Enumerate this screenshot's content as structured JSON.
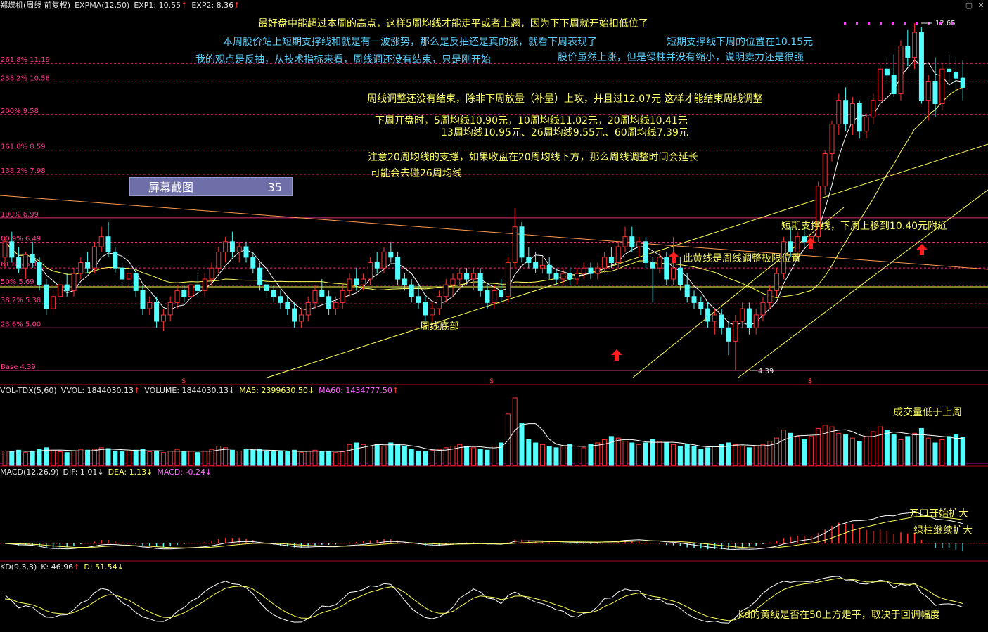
{
  "header": {
    "title": "郑煤机(周线 前复权)",
    "indicator": "EXPMA(12,50)",
    "exp1": "EXP1: 10.55",
    "exp1_arrow": "↑",
    "exp2": "EXP2: 8.36",
    "exp2_arrow": "↑"
  },
  "vol_header": {
    "name": "VOL-TDX(5,60)",
    "vvol": "VVOL: 1844030.13",
    "vvol_arrow": "↑",
    "volume": "VOLUME: 1844030.13",
    "volume_arrow": "↓",
    "ma5": "MA5: 2399630.50",
    "ma5_arrow": "↓",
    "ma60": "MA60: 1434777.50",
    "ma60_arrow": "↑"
  },
  "macd_header": {
    "name": "MACD(12,26,9)",
    "dif": "DIF: 1.01",
    "dif_arrow": "↓",
    "dea": "DEA: 1.13",
    "dea_arrow": "↓",
    "macd": "MACD: -0.24",
    "macd_arrow": "↓"
  },
  "kd_header": {
    "name": "KD(9,3,3)",
    "k": "K: 46.96",
    "k_arrow": "↑",
    "d": "D: 51.54",
    "d_arrow": "↓"
  },
  "screenshot_box": {
    "label": "屏幕截图",
    "number": "35"
  },
  "fib_levels": [
    {
      "label": "261.8% 11.19",
      "price": 11.19
    },
    {
      "label": "238.2% 10.58",
      "price": 10.58
    },
    {
      "label": "200% 9.58",
      "price": 9.58
    },
    {
      "label": "161.8% 8.59",
      "price": 8.59
    },
    {
      "label": "138.2% 7.98",
      "price": 7.98
    },
    {
      "label": "100% 6.99",
      "price": 6.99
    },
    {
      "label": "80.9% 6.49",
      "price": 6.49
    },
    {
      "label": "61.8% 6.00",
      "price": 6.0
    },
    {
      "label": "50% 5.69",
      "price": 5.69
    },
    {
      "label": "38.2% 5.38",
      "price": 5.38
    },
    {
      "label": "23.6% 5.00",
      "price": 5.0
    },
    {
      "label": "Base 4.39",
      "price": 4.39
    }
  ],
  "price_marks": {
    "high": "12.65",
    "low": "4.39"
  },
  "annotations": {
    "a1": "最好盘中能超过本周的高点，这样5周均线才能走平或者上翘，因为下下周就开始扣低位了",
    "a2": "本周股价站上短期支撑线和就是有一波涨势，那么是反抽还是真的涨，就看下周表现了",
    "a3": "短期支撑线下周的位置在10.15元",
    "a4": "我的观点是反抽，从技术指标来看，周线调还没有结束，只是刚开始",
    "a5": "股价虽然上涨，但是绿柱并没有缩小，说明卖力还是很强",
    "a6": "周线调整还没有结束，除非下周放量（补量）上攻，并且过12.07元  这样才能结束周线调整",
    "a7": "下周开盘时，5周均线10.90元，10周均线11.02元，20周均线10.41元",
    "a8": "13周均线10.95元、26周均线9.55元、60周均线7.39元",
    "a9": "注意20周均线的支撑，如果收盘在20周均线下方，那么周线调整时间会延长",
    "a10": "可能会去碰26周均线",
    "a11": "短期支撑线，下周上移到10.40元附近",
    "a12": "此黄线是周线调整极限位置",
    "a13": "周线底部",
    "a14": "成交量低于上周",
    "a15": "开口开始扩大",
    "a16": "绿柱继续扩大",
    "a17": "kd的黄线是否在50上方走平，取决于回调幅度"
  },
  "colors": {
    "up": "#ff3232",
    "down": "#54ffff",
    "ma_white": "#ffffff",
    "ma_yellow": "#ffff5a",
    "fib": "#ff3c8c",
    "text_cyan": "#5ad2ff",
    "text_yellow": "#ffff66"
  },
  "chart_data": {
    "type": "candlestick",
    "price_range": [
      4.0,
      13.2
    ],
    "candles": [
      [
        6.2,
        6.6,
        6.0,
        6.5
      ],
      [
        6.5,
        6.7,
        6.1,
        6.2
      ],
      [
        6.2,
        6.4,
        5.9,
        6.0
      ],
      [
        6.0,
        6.3,
        5.8,
        6.25
      ],
      [
        6.25,
        6.5,
        6.0,
        6.1
      ],
      [
        6.1,
        6.2,
        5.6,
        5.7
      ],
      [
        5.7,
        5.8,
        5.2,
        5.3
      ],
      [
        5.3,
        5.6,
        5.2,
        5.5
      ],
      [
        5.5,
        5.8,
        5.4,
        5.7
      ],
      [
        5.7,
        5.9,
        5.5,
        5.6
      ],
      [
        5.6,
        6.0,
        5.5,
        5.9
      ],
      [
        5.9,
        6.2,
        5.8,
        6.1
      ],
      [
        6.1,
        6.3,
        5.9,
        6.0
      ],
      [
        6.0,
        6.5,
        5.9,
        6.4
      ],
      [
        6.4,
        6.8,
        6.3,
        6.6
      ],
      [
        6.6,
        6.9,
        6.2,
        6.3
      ],
      [
        6.3,
        6.4,
        5.9,
        6.0
      ],
      [
        6.0,
        6.1,
        5.7,
        5.8
      ],
      [
        5.8,
        6.0,
        5.6,
        5.9
      ],
      [
        5.9,
        6.0,
        5.5,
        5.6
      ],
      [
        5.6,
        5.7,
        5.2,
        5.3
      ],
      [
        5.3,
        5.5,
        5.2,
        5.4
      ],
      [
        5.4,
        5.5,
        5.0,
        5.1
      ],
      [
        5.1,
        5.3,
        4.95,
        5.2
      ],
      [
        5.2,
        5.5,
        5.1,
        5.4
      ],
      [
        5.4,
        5.7,
        5.3,
        5.6
      ],
      [
        5.6,
        5.7,
        5.4,
        5.5
      ],
      [
        5.5,
        5.8,
        5.4,
        5.7
      ],
      [
        5.7,
        5.9,
        5.5,
        5.6
      ],
      [
        5.6,
        5.9,
        5.5,
        5.8
      ],
      [
        5.8,
        6.1,
        5.7,
        6.0
      ],
      [
        6.0,
        6.4,
        5.9,
        6.3
      ],
      [
        6.3,
        6.6,
        6.1,
        6.5
      ],
      [
        6.5,
        6.7,
        6.2,
        6.3
      ],
      [
        6.3,
        6.5,
        6.1,
        6.4
      ],
      [
        6.4,
        6.5,
        6.1,
        6.2
      ],
      [
        6.2,
        6.3,
        5.9,
        6.0
      ],
      [
        6.0,
        6.1,
        5.6,
        5.7
      ],
      [
        5.7,
        5.8,
        5.5,
        5.6
      ],
      [
        5.6,
        5.7,
        5.4,
        5.5
      ],
      [
        5.5,
        5.6,
        5.3,
        5.4
      ],
      [
        5.4,
        5.5,
        5.2,
        5.3
      ],
      [
        5.3,
        5.4,
        5.0,
        5.1
      ],
      [
        5.1,
        5.3,
        5.0,
        5.2
      ],
      [
        5.2,
        5.5,
        5.1,
        5.4
      ],
      [
        5.4,
        5.7,
        5.3,
        5.6
      ],
      [
        5.6,
        5.8,
        5.5,
        5.5
      ],
      [
        5.5,
        5.6,
        5.2,
        5.3
      ],
      [
        5.3,
        5.5,
        5.2,
        5.4
      ],
      [
        5.4,
        5.7,
        5.3,
        5.6
      ],
      [
        5.6,
        5.9,
        5.5,
        5.8
      ],
      [
        5.8,
        6.0,
        5.6,
        5.7
      ],
      [
        5.7,
        5.9,
        5.6,
        5.8
      ],
      [
        5.8,
        6.2,
        5.7,
        6.1
      ],
      [
        6.1,
        6.3,
        5.9,
        6.0
      ],
      [
        6.0,
        6.4,
        5.9,
        6.3
      ],
      [
        6.3,
        6.5,
        6.1,
        6.2
      ],
      [
        6.2,
        6.3,
        5.7,
        5.8
      ],
      [
        5.8,
        5.9,
        5.6,
        5.7
      ],
      [
        5.7,
        5.8,
        5.4,
        5.5
      ],
      [
        5.5,
        5.7,
        5.3,
        5.4
      ],
      [
        5.4,
        5.5,
        5.1,
        5.2
      ],
      [
        5.2,
        5.4,
        5.1,
        5.3
      ],
      [
        5.3,
        5.6,
        5.2,
        5.5
      ],
      [
        5.5,
        5.8,
        5.4,
        5.7
      ],
      [
        5.7,
        5.9,
        5.5,
        5.8
      ],
      [
        5.8,
        6.0,
        5.6,
        5.9
      ],
      [
        5.9,
        6.0,
        5.7,
        5.8
      ],
      [
        5.8,
        6.0,
        5.6,
        5.9
      ],
      [
        5.9,
        6.0,
        5.5,
        5.6
      ],
      [
        5.6,
        5.7,
        5.3,
        5.4
      ],
      [
        5.4,
        5.7,
        5.3,
        5.6
      ],
      [
        5.6,
        5.8,
        5.4,
        5.5
      ],
      [
        5.5,
        6.2,
        5.4,
        6.1
      ],
      [
        6.1,
        7.2,
        6.0,
        6.8
      ],
      [
        6.8,
        6.9,
        6.1,
        6.2
      ],
      [
        6.2,
        6.4,
        6.0,
        6.1
      ],
      [
        6.1,
        6.3,
        5.9,
        6.0
      ],
      [
        6.0,
        6.2,
        5.9,
        6.05
      ],
      [
        6.05,
        6.2,
        5.8,
        5.9
      ],
      [
        5.9,
        6.0,
        5.7,
        5.8
      ],
      [
        5.8,
        6.0,
        5.7,
        5.9
      ],
      [
        5.9,
        6.0,
        5.7,
        5.8
      ],
      [
        5.8,
        6.0,
        5.7,
        5.9
      ],
      [
        5.9,
        6.1,
        5.8,
        6.0
      ],
      [
        6.0,
        6.1,
        5.8,
        5.9
      ],
      [
        5.9,
        6.1,
        5.8,
        6.0
      ],
      [
        6.0,
        6.3,
        5.9,
        6.2
      ],
      [
        6.2,
        6.4,
        6.0,
        6.1
      ],
      [
        6.1,
        6.5,
        6.0,
        6.4
      ],
      [
        6.4,
        6.8,
        6.3,
        6.6
      ],
      [
        6.6,
        6.8,
        6.3,
        6.4
      ],
      [
        6.4,
        6.6,
        6.2,
        6.5
      ],
      [
        6.5,
        6.6,
        6.0,
        6.1
      ],
      [
        6.1,
        6.2,
        5.4,
        6.0
      ],
      [
        6.0,
        6.3,
        5.9,
        6.2
      ],
      [
        6.2,
        6.3,
        5.7,
        5.8
      ],
      [
        5.8,
        6.6,
        5.7,
        6.0
      ],
      [
        6.0,
        6.2,
        5.6,
        5.7
      ],
      [
        5.7,
        5.9,
        5.4,
        5.5
      ],
      [
        5.5,
        5.6,
        5.3,
        5.4
      ],
      [
        5.4,
        5.5,
        5.2,
        5.3
      ],
      [
        5.3,
        5.4,
        5.0,
        5.1
      ],
      [
        5.1,
        5.3,
        4.9,
        5.2
      ],
      [
        5.2,
        5.3,
        4.9,
        5.0
      ],
      [
        5.0,
        5.1,
        4.6,
        4.8
      ],
      [
        4.8,
        5.2,
        4.39,
        5.1
      ],
      [
        5.1,
        5.4,
        5.0,
        5.3
      ],
      [
        5.3,
        5.4,
        4.9,
        5.0
      ],
      [
        5.0,
        5.3,
        4.9,
        5.2
      ],
      [
        5.2,
        5.5,
        5.1,
        5.4
      ],
      [
        5.4,
        5.7,
        5.3,
        5.6
      ],
      [
        5.6,
        6.0,
        5.5,
        5.9
      ],
      [
        5.9,
        6.6,
        5.8,
        6.5
      ],
      [
        6.5,
        6.8,
        6.2,
        6.3
      ],
      [
        6.3,
        6.7,
        6.2,
        6.6
      ],
      [
        6.6,
        6.8,
        6.4,
        6.5
      ],
      [
        6.5,
        7.0,
        6.3,
        6.6
      ],
      [
        6.6,
        7.8,
        6.5,
        7.7
      ],
      [
        7.7,
        8.6,
        7.5,
        8.5
      ],
      [
        8.5,
        9.4,
        8.3,
        9.3
      ],
      [
        9.3,
        10.2,
        9.0,
        10.0
      ],
      [
        10.0,
        10.4,
        9.1,
        9.3
      ],
      [
        9.3,
        10.1,
        9.0,
        9.9
      ],
      [
        9.9,
        10.0,
        8.9,
        9.1
      ],
      [
        9.1,
        9.6,
        8.9,
        9.5
      ],
      [
        9.5,
        10.2,
        9.3,
        10.0
      ],
      [
        10.0,
        11.2,
        9.8,
        11.0
      ],
      [
        11.0,
        11.4,
        10.5,
        10.8
      ],
      [
        10.8,
        11.5,
        10.1,
        10.2
      ],
      [
        10.2,
        12.0,
        10.0,
        11.8
      ],
      [
        11.8,
        12.4,
        11.1,
        11.4
      ],
      [
        11.4,
        12.65,
        11.0,
        12.3
      ],
      [
        12.3,
        12.5,
        9.9,
        10.0
      ],
      [
        10.0,
        10.8,
        9.4,
        10.6
      ],
      [
        10.6,
        11.4,
        9.5,
        9.9
      ],
      [
        9.9,
        11.2,
        9.7,
        11.0
      ],
      [
        11.0,
        11.5,
        10.6,
        10.9
      ],
      [
        10.9,
        11.4,
        10.2,
        10.7
      ],
      [
        10.7,
        11.3,
        10.0,
        10.4
      ]
    ],
    "volumes": [
      0.9,
      0.85,
      0.95,
      0.8,
      0.9,
      1.0,
      1.1,
      0.95,
      0.85,
      0.8,
      0.9,
      1.0,
      0.95,
      1.0,
      1.1,
      1.05,
      0.9,
      0.85,
      0.9,
      0.95,
      1.0,
      0.85,
      0.9,
      0.8,
      0.9,
      1.0,
      0.85,
      0.9,
      0.8,
      0.9,
      1.0,
      1.2,
      1.1,
      0.95,
      0.9,
      1.0,
      0.95,
      1.0,
      0.9,
      0.85,
      0.9,
      0.85,
      0.95,
      0.8,
      0.9,
      0.95,
      0.85,
      0.9,
      0.8,
      0.85,
      1.3,
      1.4,
      1.3,
      1.2,
      1.3,
      1.2,
      1.4,
      1.3,
      1.2,
      1.0,
      0.9,
      0.85,
      0.95,
      1.0,
      1.1,
      1.2,
      1.3,
      1.2,
      1.1,
      1.0,
      0.95,
      1.2,
      1.4,
      3.2,
      4.2,
      2.6,
      1.6,
      1.4,
      1.3,
      1.2,
      1.1,
      1.2,
      1.3,
      1.2,
      1.1,
      1.3,
      1.4,
      1.6,
      1.8,
      1.7,
      1.5,
      1.4,
      1.3,
      1.4,
      1.6,
      1.5,
      1.4,
      1.3,
      1.2,
      1.3,
      1.2,
      1.0,
      1.1,
      1.2,
      1.3,
      1.4,
      1.3,
      1.2,
      1.1,
      1.2,
      1.3,
      1.5,
      1.7,
      2.2,
      2.0,
      1.8,
      1.6,
      1.8,
      2.3,
      2.5,
      2.4,
      2.0,
      1.9,
      1.7,
      1.5,
      1.8,
      2.1,
      2.4,
      2.2,
      1.9,
      1.6,
      1.8,
      2.0,
      2.3,
      1.7,
      1.4,
      1.6,
      1.8,
      1.9,
      1.75
    ],
    "vol_range": [
      0,
      4.2
    ],
    "fib_prices": [
      11.19,
      10.58,
      9.58,
      8.59,
      7.98,
      6.99,
      6.49,
      6.0,
      5.69,
      5.38,
      5.0,
      4.39
    ]
  }
}
